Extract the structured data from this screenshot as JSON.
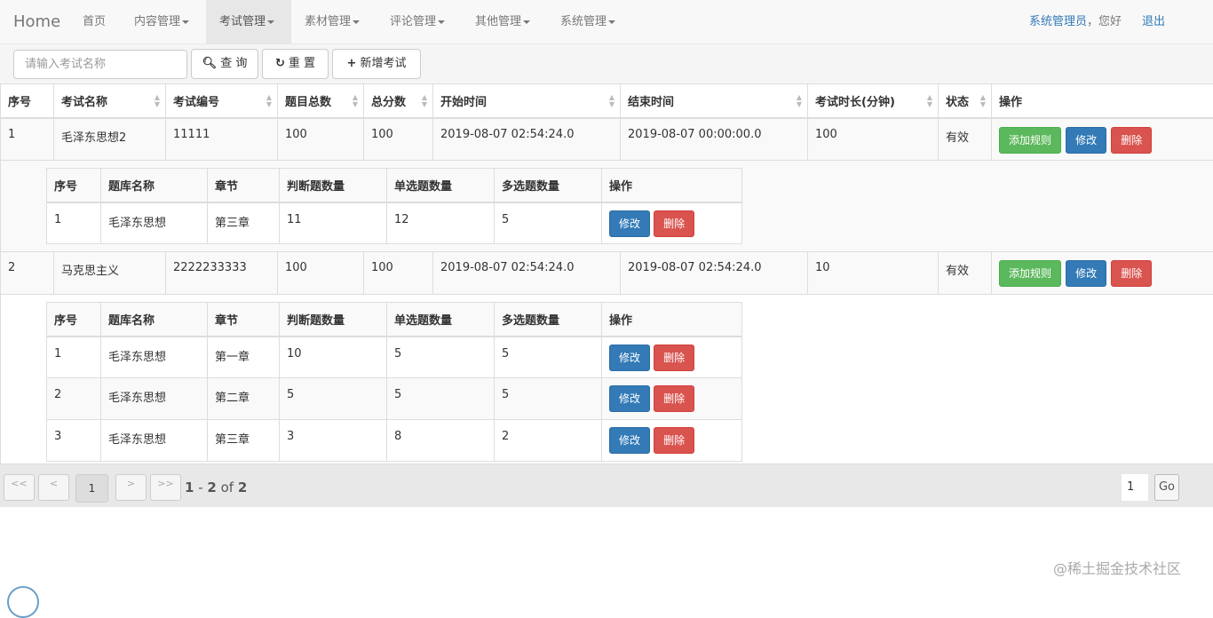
{
  "nav": {
    "brand": "Home",
    "items": [
      "首页",
      "内容管理",
      "考试管理",
      "素材管理",
      "评论管理",
      "其他管理",
      "系统管理"
    ],
    "user_name": "系统管理员",
    "user_suffix": "，您好",
    "logout": "退出"
  },
  "toolbar": {
    "search_placeholder": "请输入考试名称",
    "query": "查 询",
    "reset": "重 置",
    "add": "新增考试"
  },
  "table": {
    "headers": [
      "序号",
      "考试名称",
      "考试编号",
      "题目总数",
      "总分数",
      "开始时间",
      "结束时间",
      "考试时长(分钟)",
      "状态",
      "操作"
    ],
    "rows": [
      {
        "no": "1",
        "name": "毛泽东思想2",
        "code": "11111",
        "questions": "100",
        "score": "100",
        "start": "2019-08-07 02:54:24.0",
        "end": "2019-08-07 00:00:00.0",
        "duration": "100",
        "status": "有效",
        "rules": [
          {
            "no": "1",
            "bank": "毛泽东思想",
            "chapter": "第三章",
            "judge": "11",
            "single": "12",
            "multi": "5"
          }
        ]
      },
      {
        "no": "2",
        "name": "马克思主义",
        "code": "2222233333",
        "questions": "100",
        "score": "100",
        "start": "2019-08-07 02:54:24.0",
        "end": "2019-08-07 02:54:24.0",
        "duration": "10",
        "status": "有效",
        "rules": [
          {
            "no": "1",
            "bank": "毛泽东思想",
            "chapter": "第一章",
            "judge": "10",
            "single": "5",
            "multi": "5"
          },
          {
            "no": "2",
            "bank": "毛泽东思想",
            "chapter": "第二章",
            "judge": "5",
            "single": "5",
            "multi": "5"
          },
          {
            "no": "3",
            "bank": "毛泽东思想",
            "chapter": "第三章",
            "judge": "3",
            "single": "8",
            "multi": "2"
          }
        ]
      }
    ],
    "actions": {
      "add_rule": "添加规则",
      "edit": "修改",
      "delete": "删除"
    }
  },
  "subtable": {
    "headers": [
      "序号",
      "题库名称",
      "章节",
      "判断题数量",
      "单选题数量",
      "多选题数量",
      "操作"
    ]
  },
  "pager": {
    "first": "<<",
    "prev": "<",
    "current": "1",
    "next": ">",
    "last": ">>",
    "range_start": "1",
    "range_sep": " - ",
    "range_end": "2",
    "of": " of ",
    "total": "2",
    "page_input": "1",
    "go": "Go"
  },
  "watermark": "@稀土掘金技术社区"
}
